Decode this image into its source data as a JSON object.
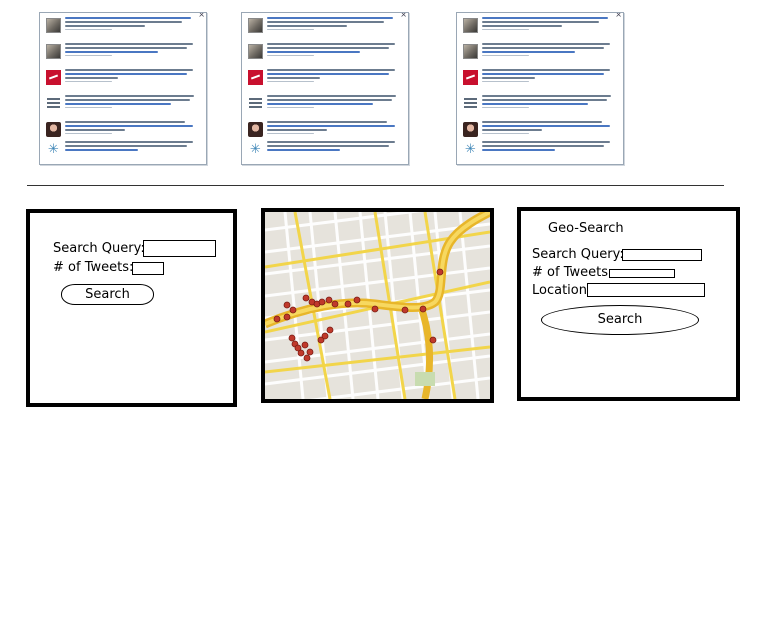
{
  "feeds": [
    {
      "close_icon": "×"
    },
    {
      "close_icon": "×"
    },
    {
      "close_icon": "×"
    }
  ],
  "search_box": {
    "query_label": "Search Query:",
    "tweets_label": "# of Tweets:",
    "button_label": "Search"
  },
  "map": {
    "marker_color": "#c0392b",
    "road_color": "#f2c230"
  },
  "geo_search_box": {
    "title": "Geo-Search",
    "query_label": "Search Query:",
    "tweets_label": "# of Tweets",
    "location_label": "Location",
    "button_label": "Search"
  }
}
